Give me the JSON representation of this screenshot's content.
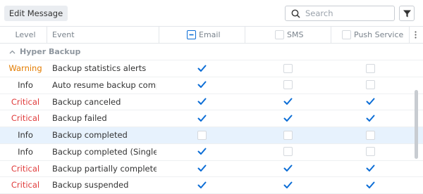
{
  "toolbar": {
    "edit_label": "Edit Message",
    "search_placeholder": "Search"
  },
  "columns": {
    "level": "Level",
    "event": "Event",
    "email": "Email",
    "sms": "SMS",
    "push": "Push Service"
  },
  "group": {
    "label": "Hyper Backup"
  },
  "colors": {
    "warning": "#e37c00",
    "critical": "#e03c3c",
    "info": "#333333",
    "accent": "#0b6dd6",
    "selected_row": "#e7f2fd"
  },
  "rows": [
    {
      "level": "Warning",
      "level_type": "warning",
      "event": "Backup statistics alerts",
      "email": true,
      "sms": false,
      "push": false,
      "selected": false
    },
    {
      "level": "Info",
      "level_type": "info",
      "event": "Auto resume backup completed",
      "email": true,
      "sms": false,
      "push": false,
      "selected": false
    },
    {
      "level": "Critical",
      "level_type": "critical",
      "event": "Backup canceled",
      "email": true,
      "sms": true,
      "push": true,
      "selected": false
    },
    {
      "level": "Critical",
      "level_type": "critical",
      "event": "Backup failed",
      "email": true,
      "sms": true,
      "push": true,
      "selected": false
    },
    {
      "level": "Info",
      "level_type": "info",
      "event": "Backup completed",
      "email": false,
      "sms": false,
      "push": false,
      "selected": true
    },
    {
      "level": "Info",
      "level_type": "info",
      "event": "Backup completed (Single-v",
      "email": true,
      "sms": false,
      "push": false,
      "selected": false
    },
    {
      "level": "Critical",
      "level_type": "critical",
      "event": "Backup partially completed",
      "email": true,
      "sms": true,
      "push": true,
      "selected": false
    },
    {
      "level": "Critical",
      "level_type": "critical",
      "event": "Backup suspended",
      "email": true,
      "sms": true,
      "push": true,
      "selected": false
    }
  ]
}
